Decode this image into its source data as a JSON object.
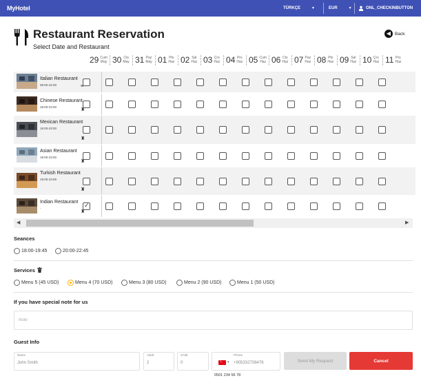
{
  "app": {
    "brand": "MyHotel",
    "language": "TÜRKÇE",
    "currency": "EUR",
    "user": "ONL_CHECKINBUTTON"
  },
  "page": {
    "title": "Restaurant Reservation",
    "subtitle": "Select Date and Restaurant",
    "back_label": "Back"
  },
  "dates": [
    {
      "num": "29",
      "day": "Cum",
      "month": "May"
    },
    {
      "num": "30",
      "day": "Cts",
      "month": "May"
    },
    {
      "num": "31",
      "day": "Paz",
      "month": "May"
    },
    {
      "num": "01",
      "day": "Pts",
      "month": "Haz"
    },
    {
      "num": "02",
      "day": "Sal",
      "month": "Haz"
    },
    {
      "num": "03",
      "day": "Çrs",
      "month": "Haz"
    },
    {
      "num": "04",
      "day": "Prs",
      "month": "Haz"
    },
    {
      "num": "05",
      "day": "Cum",
      "month": "Haz"
    },
    {
      "num": "06",
      "day": "Cts",
      "month": "Haz"
    },
    {
      "num": "07",
      "day": "Paz",
      "month": "Haz"
    },
    {
      "num": "08",
      "day": "Pts",
      "month": "Haz"
    },
    {
      "num": "09",
      "day": "Sal",
      "month": "Haz"
    },
    {
      "num": "10",
      "day": "Çrs",
      "month": "Haz"
    },
    {
      "num": "11",
      "day": "Prs",
      "month": "Haz"
    }
  ],
  "restaurants": [
    {
      "name": "Italian Restaurant",
      "time": "08:00-22:00",
      "icon": "menu-icon",
      "checked": []
    },
    {
      "name": "Chinese Restaurant",
      "time": "18:00-23:00",
      "icon": "dress-code-icon",
      "checked": []
    },
    {
      "name": "Mexican Restaurant",
      "time": "19:00-23:00",
      "icon": "dress-code-icon",
      "checked": []
    },
    {
      "name": "Asian Restaurant",
      "time": "19:00-23:00",
      "icon": "dress-code-icon",
      "checked": []
    },
    {
      "name": "Turkish Restaurant",
      "time": "19:00-23:59",
      "icon": "dress-code-icon",
      "checked": []
    },
    {
      "name": "Indian Restaurant",
      "time": "-",
      "icon": "dress-code-icon",
      "checked": [
        0
      ]
    }
  ],
  "seances": {
    "title": "Seances",
    "options": [
      "18:00-19:45",
      "20:00-22:45"
    ],
    "selected": -1
  },
  "services": {
    "title": "Services",
    "options": [
      "Menu 5 (45 USD)",
      "Menu 4 (70 USD)",
      "Menu 3 (80 USD)",
      "Menu 2 (90 USD)",
      "Menu 1 (50 USD)"
    ],
    "selected": 1
  },
  "note": {
    "title": "If you have special note for us",
    "placeholder": "Note"
  },
  "guest": {
    "title": "Guest Info",
    "name_label": "Name",
    "name_placeholder": "John Smith",
    "adult_label": "Adult",
    "adult_value": "2",
    "child_label": "Child",
    "child_value": "0",
    "phone_label": "Phone",
    "phone_placeholder": "+905332708476",
    "phone_hint": "0501 234 56 78",
    "send_label": "Send My Request",
    "cancel_label": "Cancel"
  },
  "colors": {
    "topbar": "#3f51b5",
    "selected_radio": "#ffb300",
    "cancel": "#e53935"
  }
}
